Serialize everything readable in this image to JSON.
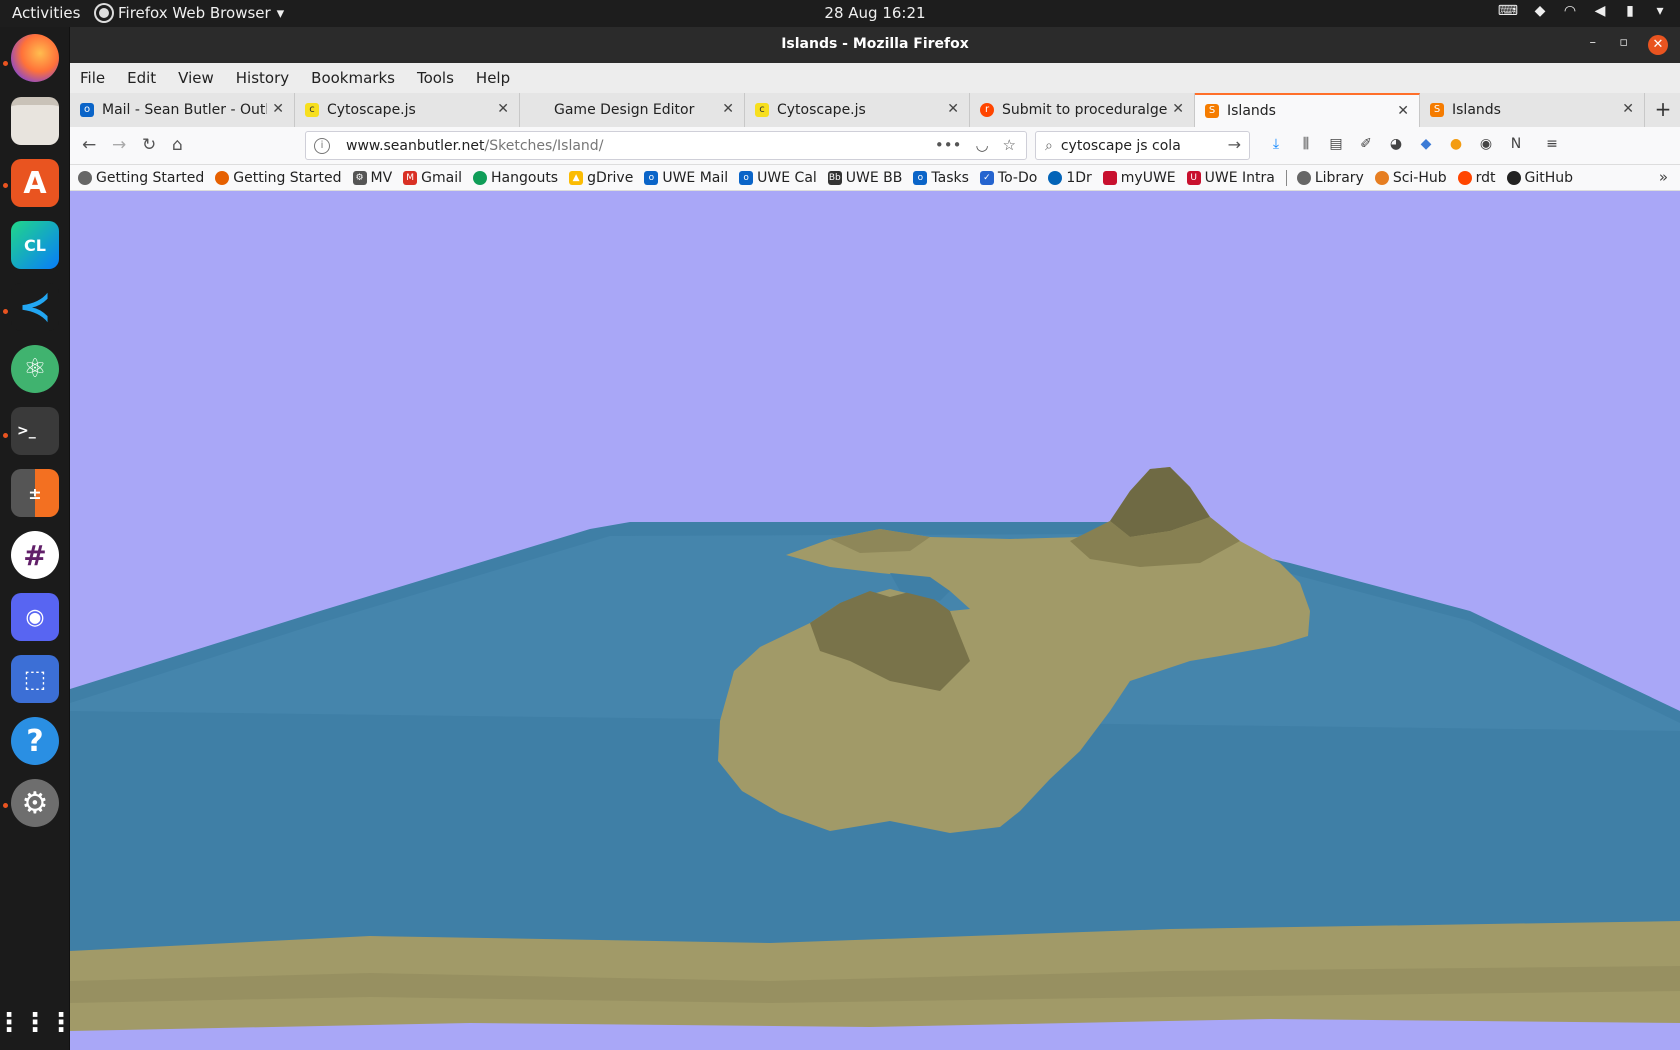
{
  "topbar": {
    "activities": "Activities",
    "app_menu": "Firefox Web Browser",
    "clock": "28 Aug  16:21"
  },
  "window": {
    "title": "Islands - Mozilla Firefox"
  },
  "menu": [
    "File",
    "Edit",
    "View",
    "History",
    "Bookmarks",
    "Tools",
    "Help"
  ],
  "tabs": [
    {
      "label": "Mail - Sean Butler - Outlo",
      "icon": "outlook-icon",
      "color": "#0a64c8"
    },
    {
      "label": "Cytoscape.js",
      "icon": "cytoscape-icon",
      "color": "#f7df1e"
    },
    {
      "label": "Game Design Editor",
      "icon": "",
      "color": ""
    },
    {
      "label": "Cytoscape.js",
      "icon": "cytoscape-icon",
      "color": "#f7df1e"
    },
    {
      "label": "Submit to proceduralge",
      "icon": "reddit-icon",
      "color": "#ff4500"
    },
    {
      "label": "Islands",
      "icon": "sketch-icon",
      "color": "#f57c00",
      "active": true
    },
    {
      "label": "Islands",
      "icon": "sketch-icon",
      "color": "#f57c00"
    }
  ],
  "urlbar": {
    "host": "www.seanbutler.net",
    "path": "/Sketches/Island/"
  },
  "search": {
    "value": "cytoscape js cola"
  },
  "bookmarks": [
    {
      "label": "Getting Started",
      "color": "#666"
    },
    {
      "label": "Getting Started",
      "color": "#e66000"
    },
    {
      "label": "MV",
      "color": "#555"
    },
    {
      "label": "Gmail",
      "color": "#d93025"
    },
    {
      "label": "Hangouts",
      "color": "#0f9d58"
    },
    {
      "label": "gDrive",
      "color": "#fbbc04"
    },
    {
      "label": "UWE Mail",
      "color": "#0a64c8"
    },
    {
      "label": "UWE Cal",
      "color": "#0a64c8"
    },
    {
      "label": "UWE BB",
      "color": "#333"
    },
    {
      "label": "Tasks",
      "color": "#0a64c8"
    },
    {
      "label": "To-Do",
      "color": "#2564cf"
    },
    {
      "label": "1Dr",
      "color": "#0364b8"
    },
    {
      "label": "myUWE",
      "color": "#c8102e"
    },
    {
      "label": "UWE Intra",
      "color": "#c8102e"
    },
    {
      "label": "Library",
      "color": "#666"
    },
    {
      "label": "Sci-Hub",
      "color": "#e67e22"
    },
    {
      "label": "rdt",
      "color": "#ff4500"
    },
    {
      "label": "GitHub",
      "color": "#222"
    }
  ],
  "scene": {
    "sky_color": "#a9a7f7",
    "sea_color": "#3f7fa6",
    "land_color": "#a19a68"
  }
}
